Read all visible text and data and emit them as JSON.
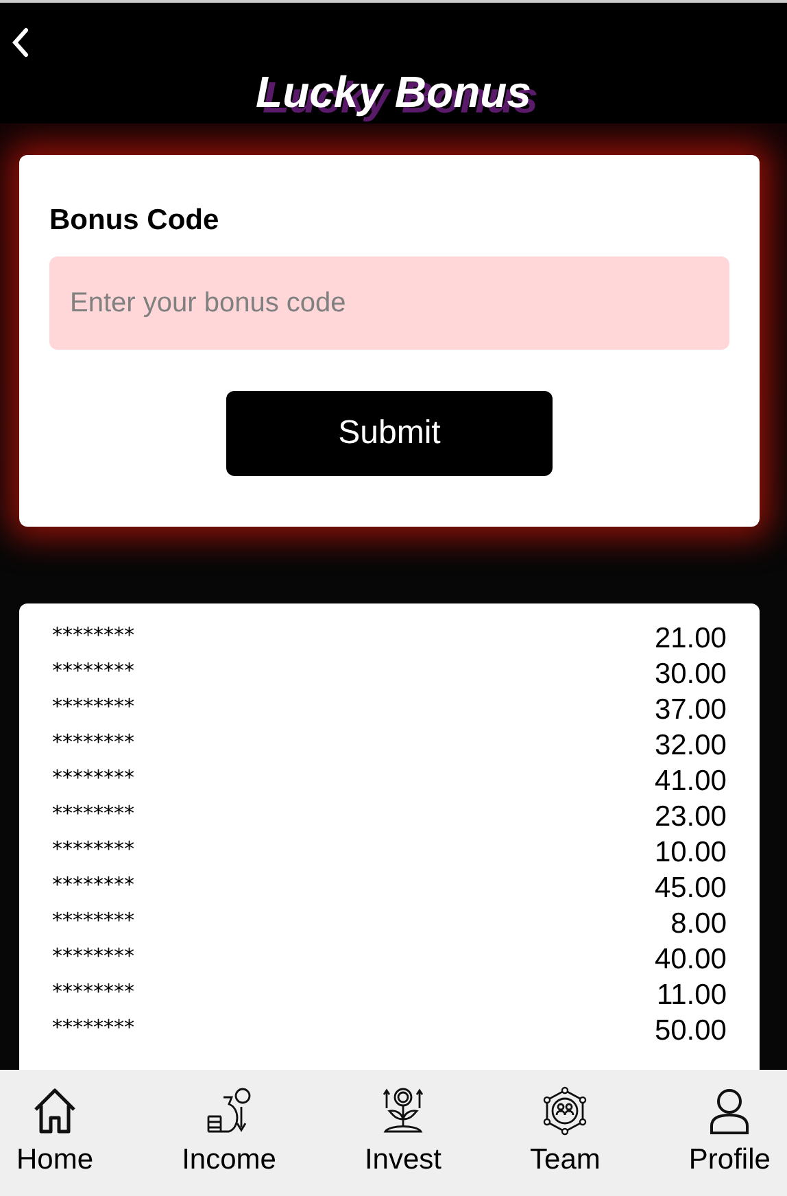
{
  "header": {
    "title": "Lucky Bonus"
  },
  "form": {
    "label": "Bonus Code",
    "placeholder": "Enter your bonus code",
    "button": "Submit"
  },
  "records": [
    {
      "code": "********",
      "amount": "21.00"
    },
    {
      "code": "********",
      "amount": "30.00"
    },
    {
      "code": "********",
      "amount": "37.00"
    },
    {
      "code": "********",
      "amount": "32.00"
    },
    {
      "code": "********",
      "amount": "41.00"
    },
    {
      "code": "********",
      "amount": "23.00"
    },
    {
      "code": "********",
      "amount": "10.00"
    },
    {
      "code": "********",
      "amount": "45.00"
    },
    {
      "code": "********",
      "amount": "8.00"
    },
    {
      "code": "********",
      "amount": "40.00"
    },
    {
      "code": "********",
      "amount": "11.00"
    },
    {
      "code": "********",
      "amount": "50.00"
    }
  ],
  "nav": [
    {
      "kind": "home",
      "label": "Home"
    },
    {
      "kind": "income",
      "label": "Income"
    },
    {
      "kind": "invest",
      "label": "Invest"
    },
    {
      "kind": "team",
      "label": "Team"
    },
    {
      "kind": "profile",
      "label": "Profile"
    }
  ]
}
